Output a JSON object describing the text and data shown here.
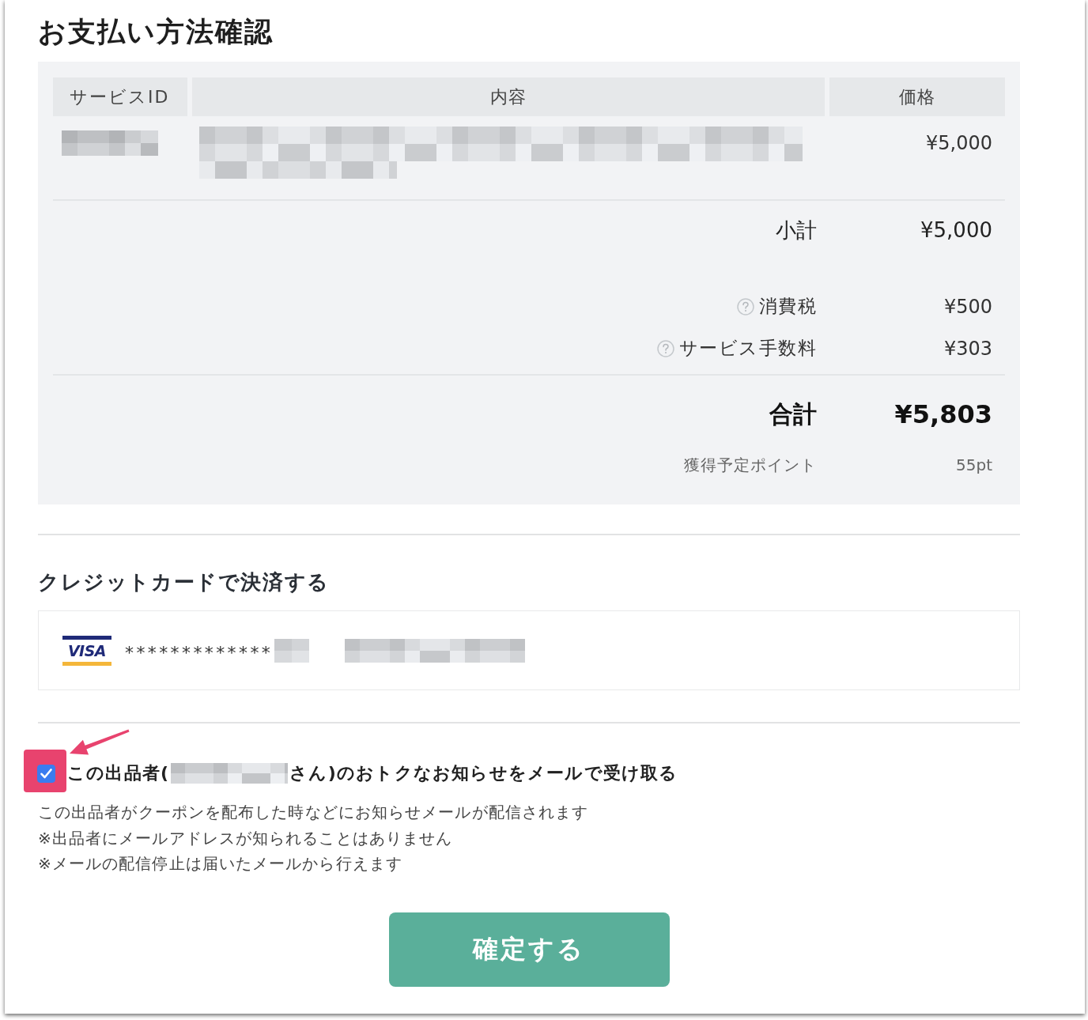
{
  "title": "お支払い方法確認",
  "order": {
    "columns": [
      "サービスID",
      "内容",
      "価格"
    ],
    "rows": [
      {
        "price": "¥5,000"
      }
    ]
  },
  "summary": [
    {
      "kind": "subtotal",
      "label": "小計",
      "amount": "¥5,000"
    },
    {
      "kind": "fee",
      "label": "消費税",
      "amount": "¥500"
    },
    {
      "kind": "fee",
      "label": "サービス手数料",
      "amount": "¥303"
    },
    {
      "kind": "total",
      "label": "合計",
      "amount": "¥5,803"
    },
    {
      "kind": "points",
      "label": "獲得予定ポイント",
      "amount": "55pt"
    }
  ],
  "payment": {
    "heading": "クレジットカードで決済する",
    "card": {
      "brand": "VISA",
      "number": "*************"
    }
  },
  "seller_optin": {
    "checked": true,
    "label_start": "この出品者(",
    "label_end": "さん)のおトクなお知らせをメールで受け取る",
    "notes": [
      "この出品者がクーポンを配布した時などにお知らせメールが配信されます",
      "※出品者にメールアドレスが知られることはありません",
      "※メールの配信停止は届いたメールから行えます"
    ]
  },
  "confirm_button": "確定する"
}
